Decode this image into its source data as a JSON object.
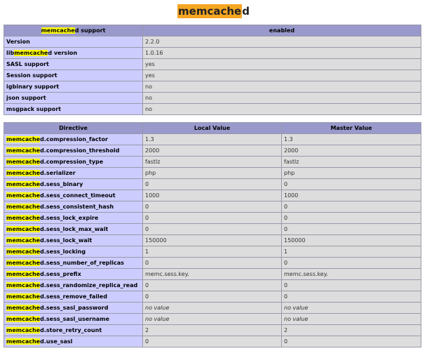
{
  "page": {
    "title_highlight": "memcache",
    "title_rest": "d"
  },
  "support_table": {
    "header": {
      "col1_hl": "memcache",
      "col1_rest": "d support",
      "col2": "enabled"
    },
    "rows": [
      {
        "pre": "Version",
        "hl": "",
        "post": "",
        "value": "2.2.0"
      },
      {
        "pre": "lib",
        "hl": "memcache",
        "post": "d version",
        "value": "1.0.16"
      },
      {
        "pre": "SASL support",
        "hl": "",
        "post": "",
        "value": "yes"
      },
      {
        "pre": "Session support",
        "hl": "",
        "post": "",
        "value": "yes"
      },
      {
        "pre": "igbinary support",
        "hl": "",
        "post": "",
        "value": "no"
      },
      {
        "pre": "json support",
        "hl": "",
        "post": "",
        "value": "no"
      },
      {
        "pre": "msgpack support",
        "hl": "",
        "post": "",
        "value": "no"
      }
    ]
  },
  "directive_table": {
    "headers": [
      "Directive",
      "Local Value",
      "Master Value"
    ],
    "hl": "memcache",
    "rows": [
      {
        "suffix": "d.compression_factor",
        "local": "1.3",
        "master": "1.3"
      },
      {
        "suffix": "d.compression_threshold",
        "local": "2000",
        "master": "2000"
      },
      {
        "suffix": "d.compression_type",
        "local": "fastlz",
        "master": "fastlz"
      },
      {
        "suffix": "d.serializer",
        "local": "php",
        "master": "php"
      },
      {
        "suffix": "d.sess_binary",
        "local": "0",
        "master": "0"
      },
      {
        "suffix": "d.sess_connect_timeout",
        "local": "1000",
        "master": "1000"
      },
      {
        "suffix": "d.sess_consistent_hash",
        "local": "0",
        "master": "0"
      },
      {
        "suffix": "d.sess_lock_expire",
        "local": "0",
        "master": "0"
      },
      {
        "suffix": "d.sess_lock_max_wait",
        "local": "0",
        "master": "0"
      },
      {
        "suffix": "d.sess_lock_wait",
        "local": "150000",
        "master": "150000"
      },
      {
        "suffix": "d.sess_locking",
        "local": "1",
        "master": "1"
      },
      {
        "suffix": "d.sess_number_of_replicas",
        "local": "0",
        "master": "0"
      },
      {
        "suffix": "d.sess_prefix",
        "local": "memc.sess.key.",
        "master": "memc.sess.key."
      },
      {
        "suffix": "d.sess_randomize_replica_read",
        "local": "0",
        "master": "0"
      },
      {
        "suffix": "d.sess_remove_failed",
        "local": "0",
        "master": "0"
      },
      {
        "suffix": "d.sess_sasl_password",
        "local": "no value",
        "master": "no value",
        "novalue": true
      },
      {
        "suffix": "d.sess_sasl_username",
        "local": "no value",
        "master": "no value",
        "novalue": true
      },
      {
        "suffix": "d.store_retry_count",
        "local": "2",
        "master": "2"
      },
      {
        "suffix": "d.use_sasl",
        "local": "0",
        "master": "0"
      }
    ]
  }
}
